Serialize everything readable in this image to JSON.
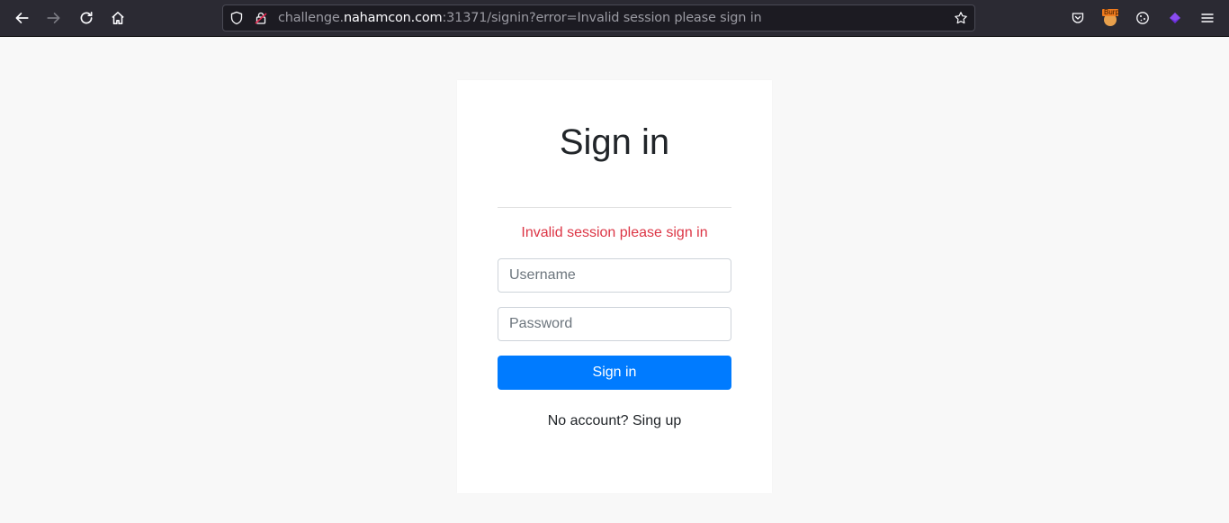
{
  "browser": {
    "url_prefix": "challenge.",
    "url_domain": "nahamcon.com",
    "url_suffix": ":31371/signin?error=Invalid session please sign in",
    "extension_badge": "Burp"
  },
  "page": {
    "title": "Sign in",
    "error_message": "Invalid session please sign in",
    "username_placeholder": "Username",
    "password_placeholder": "Password",
    "submit_label": "Sign in",
    "signup_text": "No account? Sing up"
  },
  "colors": {
    "accent": "#007bff",
    "error": "#dc3545",
    "toolbar": "#2b2a33"
  }
}
